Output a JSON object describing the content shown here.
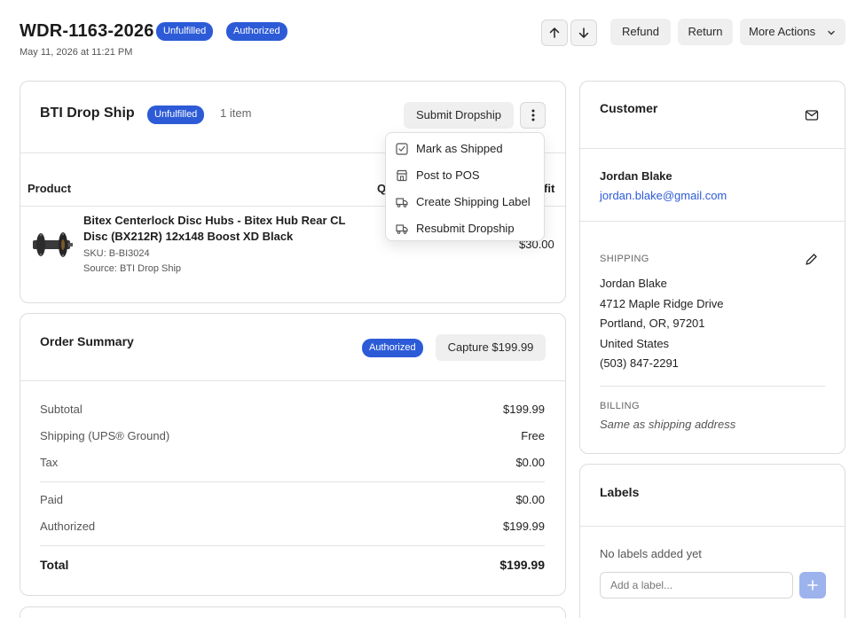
{
  "header": {
    "order_id": "WDR-1163-2026",
    "badges": [
      "Unfulfilled",
      "Authorized"
    ],
    "date": "May 11, 2026 at 11:21 PM",
    "actions": {
      "refund": "Refund",
      "return": "Return",
      "more": "More Actions"
    }
  },
  "dropship": {
    "title": "BTI Drop Ship",
    "status": "Unfulfilled",
    "item_count": "1 item",
    "submit_label": "Submit Dropship",
    "columns": {
      "product": "Product",
      "qty": "Q",
      "profit": "fit"
    },
    "product": {
      "name": "Bitex Centerlock Disc Hubs - Bitex Hub Rear CL Disc (BX212R) 12x148 Boost XD Black",
      "sku": "SKU: B-BI3024",
      "source": "Source: BTI Drop Ship",
      "profit": "$30.00"
    },
    "menu": [
      "Mark as Shipped",
      "Post to POS",
      "Create Shipping Label",
      "Resubmit Dropship"
    ]
  },
  "summary": {
    "title": "Order Summary",
    "status": "Authorized",
    "capture_label": "Capture $199.99",
    "rows": [
      {
        "label": "Subtotal",
        "value": "$199.99"
      },
      {
        "label": "Shipping (UPS® Ground)",
        "value": "Free"
      },
      {
        "label": "Tax",
        "value": "$0.00"
      },
      {
        "label": "Paid",
        "value": "$0.00"
      },
      {
        "label": "Authorized",
        "value": "$199.99"
      }
    ],
    "total_label": "Total",
    "total_value": "$199.99"
  },
  "customer": {
    "title": "Customer",
    "name": "Jordan Blake",
    "email": "jordan.blake@gmail.com",
    "shipping_label": "SHIPPING",
    "shipping": [
      "Jordan Blake",
      "4712 Maple Ridge Drive",
      "Portland, OR, 97201",
      "United States",
      "(503) 847-2291"
    ],
    "billing_label": "BILLING",
    "billing": "Same as shipping address"
  },
  "labels": {
    "title": "Labels",
    "empty": "No labels added yet",
    "placeholder": "Add a label..."
  },
  "colors": {
    "accent": "#2d5bd7",
    "link": "#2d5bd7",
    "add_button": "#9db3ee"
  }
}
